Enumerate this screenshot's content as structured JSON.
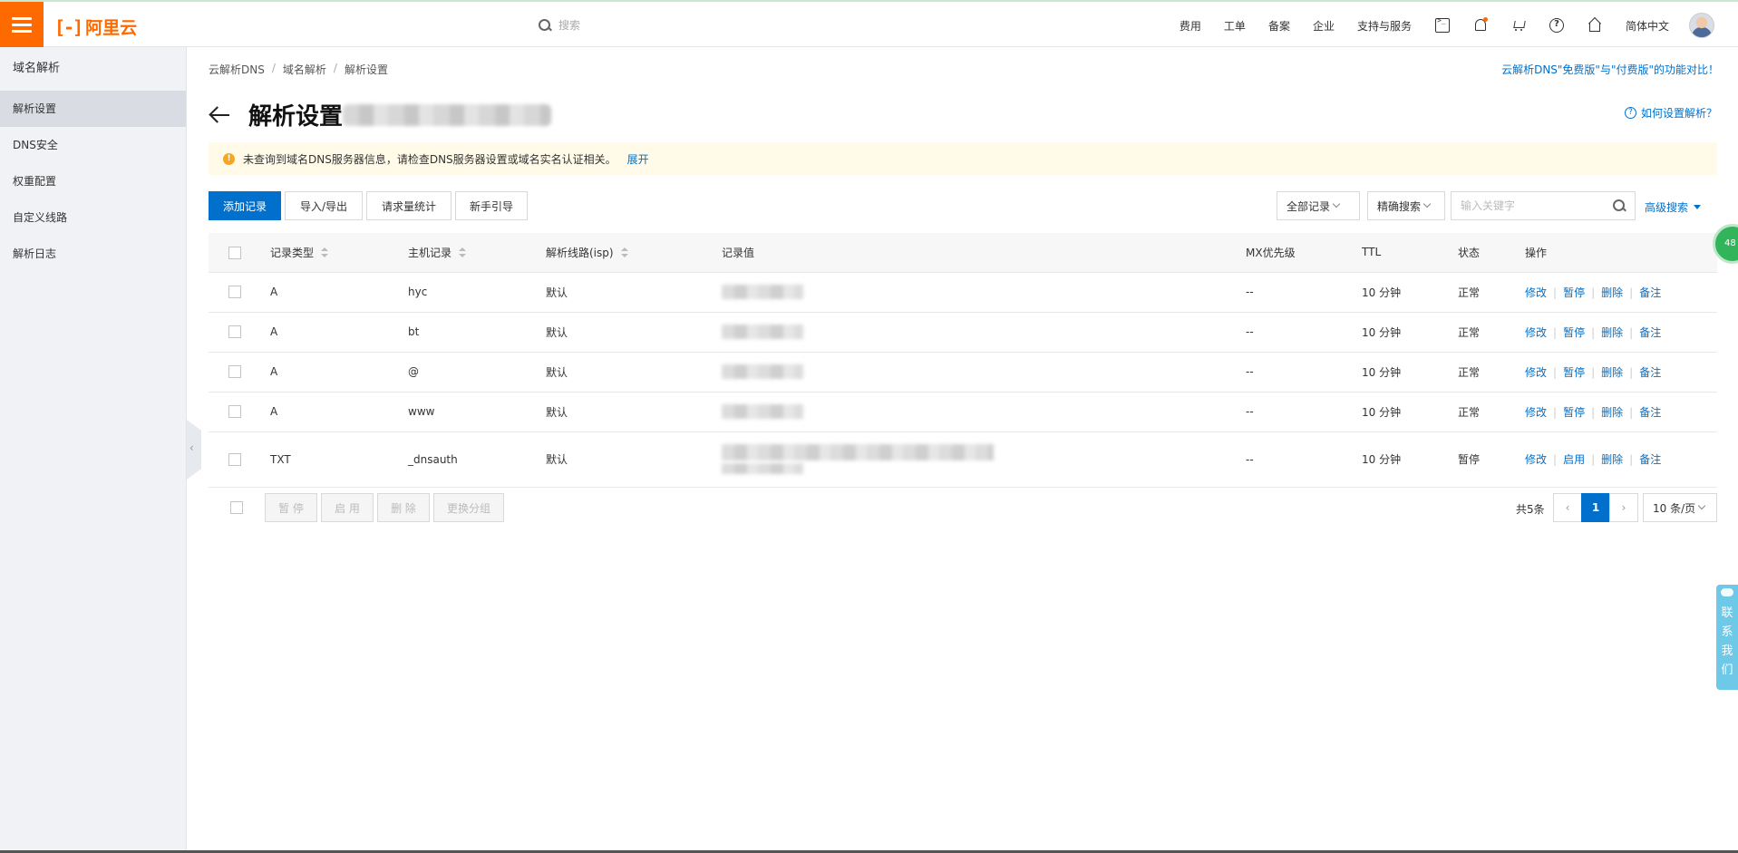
{
  "topbar": {
    "brand": "阿里云",
    "brand_mark": "[-]",
    "search_placeholder": "搜索",
    "nav": [
      "费用",
      "工单",
      "备案",
      "企业",
      "支持与服务"
    ],
    "icons": [
      "terminal-icon",
      "bell-icon",
      "cart-icon",
      "help-icon",
      "home-icon"
    ],
    "language": "简体中文"
  },
  "sidebar": {
    "title": "域名解析",
    "items": [
      "解析设置",
      "DNS安全",
      "权重配置",
      "自定义线路",
      "解析日志"
    ],
    "active": "解析设置"
  },
  "breadcrumb": [
    "云解析DNS",
    "域名解析",
    "解析设置"
  ],
  "compare_link": "云解析DNS\"免费版\"与\"付费版\"的功能对比！",
  "page_title": "解析设置",
  "howto_link": "如何设置解析？",
  "notice": {
    "text": "未查询到域名DNS服务器信息，请检查DNS服务器设置或域名实名认证相关。",
    "action": "展开"
  },
  "toolbar": {
    "add_record": "添加记录",
    "import_export": "导入/导出",
    "request_stats": "请求量统计",
    "guide": "新手引导",
    "filter_select": "全部记录",
    "search_mode": "精确搜索",
    "keyword_placeholder": "输入关键字",
    "advanced_search": "高级搜索"
  },
  "table": {
    "headers": {
      "type": "记录类型",
      "host": "主机记录",
      "line": "解析线路(isp)",
      "value": "记录值",
      "mx": "MX优先级",
      "ttl": "TTL",
      "status": "状态",
      "ops": "操作"
    },
    "rows": [
      {
        "type": "A",
        "host": "hyc",
        "line": "默认",
        "mx": "--",
        "ttl": "10 分钟",
        "status": "正常",
        "toggle": "暂停"
      },
      {
        "type": "A",
        "host": "bt",
        "line": "默认",
        "mx": "--",
        "ttl": "10 分钟",
        "status": "正常",
        "toggle": "暂停"
      },
      {
        "type": "A",
        "host": "@",
        "line": "默认",
        "mx": "--",
        "ttl": "10 分钟",
        "status": "正常",
        "toggle": "暂停"
      },
      {
        "type": "A",
        "host": "www",
        "line": "默认",
        "mx": "--",
        "ttl": "10 分钟",
        "status": "正常",
        "toggle": "暂停"
      },
      {
        "type": "TXT",
        "host": "_dnsauth",
        "line": "默认",
        "mx": "--",
        "ttl": "10 分钟",
        "status": "暂停",
        "toggle": "启用"
      }
    ],
    "op_edit": "修改",
    "op_delete": "删除",
    "op_note": "备注"
  },
  "batch": {
    "pause": "暂 停",
    "enable": "启 用",
    "delete": "删 除",
    "change_group": "更换分组"
  },
  "pagination": {
    "total": "共5条",
    "current": "1",
    "page_size": "10 条/页"
  },
  "float": {
    "badge": "48",
    "contact": [
      "联",
      "系",
      "我",
      "们"
    ]
  },
  "colors": {
    "brand": "#ff6a00",
    "link": "#0070cc",
    "ok": "#1e8e3e",
    "paused": "#f5a623"
  }
}
